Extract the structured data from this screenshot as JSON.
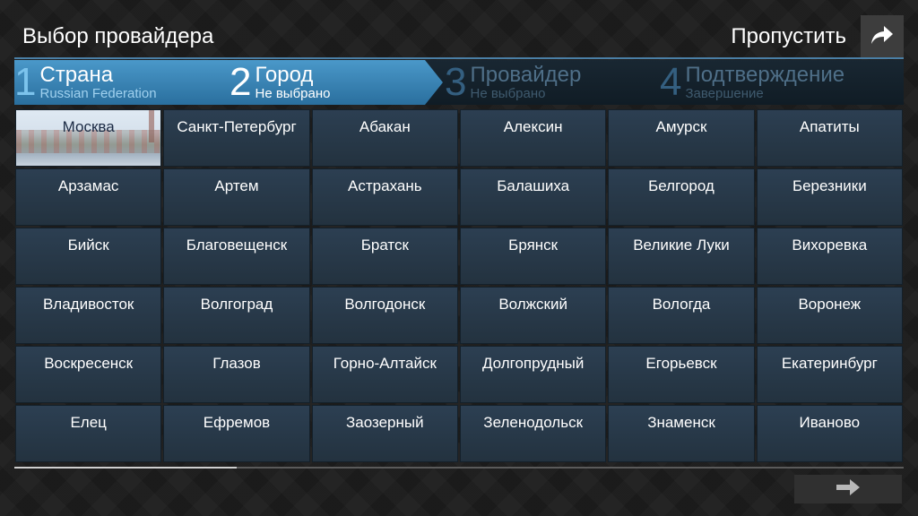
{
  "header": {
    "title": "Выбор провайдера",
    "skip_label": "Пропустить",
    "skip_icon": "share-arrow-icon"
  },
  "steps": [
    {
      "number": "1",
      "label": "Страна",
      "sub": "Russian Federation",
      "state": "completed"
    },
    {
      "number": "2",
      "label": "Город",
      "sub": "Не выбрано",
      "state": "active"
    },
    {
      "number": "3",
      "label": "Провайдер",
      "sub": "Не выбрано",
      "state": "inactive"
    },
    {
      "number": "4",
      "label": "Подтверждение",
      "sub": "Завершение",
      "state": "inactive"
    }
  ],
  "cities": [
    "Москва",
    "Санкт-Петербург",
    "Абакан",
    "Алексин",
    "Амурск",
    "Апатиты",
    "Арзамас",
    "Артем",
    "Астрахань",
    "Балашиха",
    "Белгород",
    "Березники",
    "Бийск",
    "Благовещенск",
    "Братск",
    "Брянск",
    "Великие Луки",
    "Вихоревка",
    "Владивосток",
    "Волгоград",
    "Волгодонск",
    "Волжский",
    "Вологда",
    "Воронеж",
    "Воскресенск",
    "Глазов",
    "Горно-Алтайск",
    "Долгопрудный",
    "Егорьевск",
    "Екатеринбург",
    "Елец",
    "Ефремов",
    "Заозерный",
    "Зеленодольск",
    "Знаменск",
    "Иваново"
  ],
  "selected_city": "Москва",
  "scroll_progress": 0.25,
  "footer": {
    "next_icon": "arrow-right-icon"
  },
  "colors": {
    "accent": "#4a98c9",
    "cell_bg": "#2c3f52",
    "background": "#1c1c1c"
  }
}
